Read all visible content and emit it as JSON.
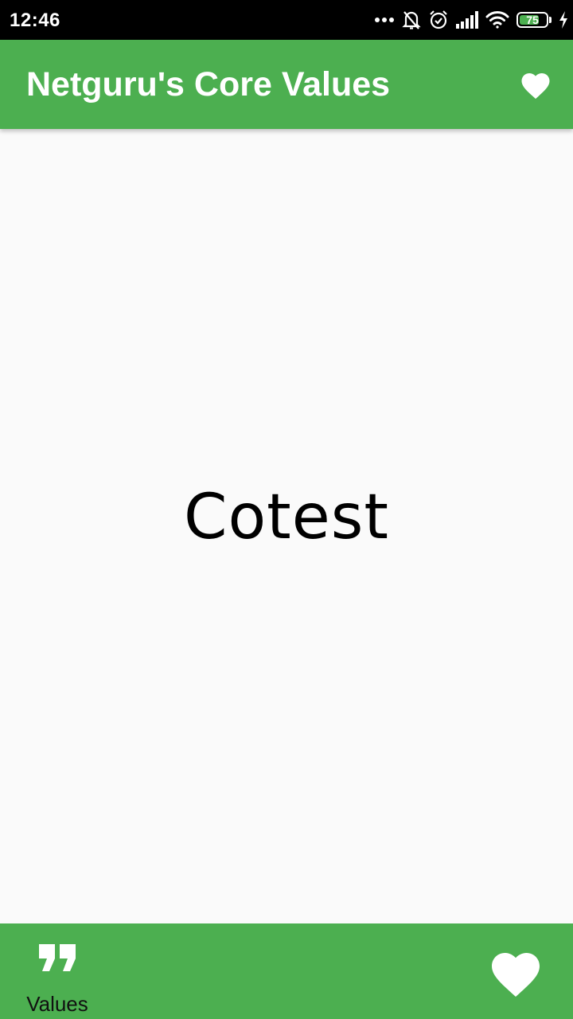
{
  "status_bar": {
    "time": "12:46",
    "battery_level": "75",
    "battery_fraction": 0.75,
    "icons": [
      "more-dots-icon",
      "bell-off-icon",
      "alarm-icon",
      "signal-icon",
      "wifi-icon",
      "battery-icon",
      "charging-icon"
    ]
  },
  "app_bar": {
    "title": "Netguru's Core Values",
    "action_icon": "heart-icon"
  },
  "main": {
    "value_text": "Cotest"
  },
  "bottom_bar": {
    "values_tab": {
      "label": "Values",
      "icon": "quote-icon"
    },
    "favorite_icon": "heart-icon"
  },
  "colors": {
    "primary": "#4caf50",
    "background": "#fafafa",
    "status_bar": "#000000",
    "on_primary": "#ffffff",
    "text": "#000000"
  }
}
